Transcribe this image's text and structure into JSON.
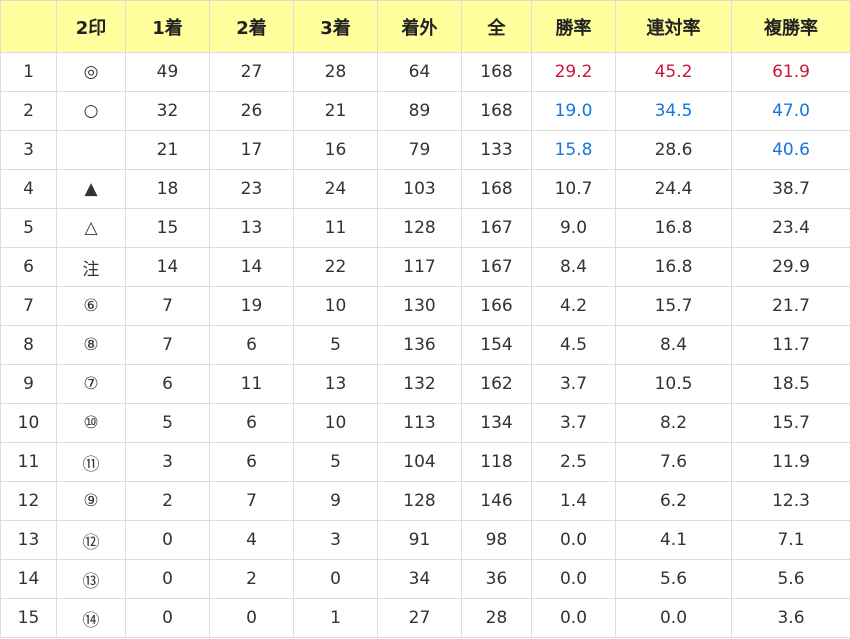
{
  "colors": {
    "header_bg": "#ffff9e",
    "high": "#c8173a",
    "mid": "#1874e0"
  },
  "headers": [
    "",
    "2印",
    "1着",
    "2着",
    "3着",
    "着外",
    "全",
    "勝率",
    "連対率",
    "複勝率"
  ],
  "rows": [
    {
      "no": "1",
      "mark": "◎",
      "c1": "49",
      "c2": "27",
      "c3": "28",
      "out": "64",
      "total": "168",
      "win": "29.2",
      "top2": "45.2",
      "top3": "61.9",
      "hl": [
        "red",
        "red",
        "red"
      ]
    },
    {
      "no": "2",
      "mark": "○",
      "c1": "32",
      "c2": "26",
      "c3": "21",
      "out": "89",
      "total": "168",
      "win": "19.0",
      "top2": "34.5",
      "top3": "47.0",
      "hl": [
        "blue",
        "blue",
        "blue"
      ]
    },
    {
      "no": "3",
      "mark": "",
      "c1": "21",
      "c2": "17",
      "c3": "16",
      "out": "79",
      "total": "133",
      "win": "15.8",
      "top2": "28.6",
      "top3": "40.6",
      "hl": [
        "blue",
        "",
        "blue"
      ]
    },
    {
      "no": "4",
      "mark": "▲",
      "c1": "18",
      "c2": "23",
      "c3": "24",
      "out": "103",
      "total": "168",
      "win": "10.7",
      "top2": "24.4",
      "top3": "38.7",
      "hl": [
        "",
        "",
        ""
      ]
    },
    {
      "no": "5",
      "mark": "△",
      "c1": "15",
      "c2": "13",
      "c3": "11",
      "out": "128",
      "total": "167",
      "win": "9.0",
      "top2": "16.8",
      "top3": "23.4",
      "hl": [
        "",
        "",
        ""
      ]
    },
    {
      "no": "6",
      "mark": "注",
      "c1": "14",
      "c2": "14",
      "c3": "22",
      "out": "117",
      "total": "167",
      "win": "8.4",
      "top2": "16.8",
      "top3": "29.9",
      "hl": [
        "",
        "",
        ""
      ]
    },
    {
      "no": "7",
      "mark": "⑥",
      "c1": "7",
      "c2": "19",
      "c3": "10",
      "out": "130",
      "total": "166",
      "win": "4.2",
      "top2": "15.7",
      "top3": "21.7",
      "hl": [
        "",
        "",
        ""
      ]
    },
    {
      "no": "8",
      "mark": "⑧",
      "c1": "7",
      "c2": "6",
      "c3": "5",
      "out": "136",
      "total": "154",
      "win": "4.5",
      "top2": "8.4",
      "top3": "11.7",
      "hl": [
        "",
        "",
        ""
      ]
    },
    {
      "no": "9",
      "mark": "⑦",
      "c1": "6",
      "c2": "11",
      "c3": "13",
      "out": "132",
      "total": "162",
      "win": "3.7",
      "top2": "10.5",
      "top3": "18.5",
      "hl": [
        "",
        "",
        ""
      ]
    },
    {
      "no": "10",
      "mark": "⑩",
      "c1": "5",
      "c2": "6",
      "c3": "10",
      "out": "113",
      "total": "134",
      "win": "3.7",
      "top2": "8.2",
      "top3": "15.7",
      "hl": [
        "",
        "",
        ""
      ]
    },
    {
      "no": "11",
      "mark": "⑪",
      "c1": "3",
      "c2": "6",
      "c3": "5",
      "out": "104",
      "total": "118",
      "win": "2.5",
      "top2": "7.6",
      "top3": "11.9",
      "hl": [
        "",
        "",
        ""
      ]
    },
    {
      "no": "12",
      "mark": "⑨",
      "c1": "2",
      "c2": "7",
      "c3": "9",
      "out": "128",
      "total": "146",
      "win": "1.4",
      "top2": "6.2",
      "top3": "12.3",
      "hl": [
        "",
        "",
        ""
      ]
    },
    {
      "no": "13",
      "mark": "⑫",
      "c1": "0",
      "c2": "4",
      "c3": "3",
      "out": "91",
      "total": "98",
      "win": "0.0",
      "top2": "4.1",
      "top3": "7.1",
      "hl": [
        "",
        "",
        ""
      ]
    },
    {
      "no": "14",
      "mark": "⑬",
      "c1": "0",
      "c2": "2",
      "c3": "0",
      "out": "34",
      "total": "36",
      "win": "0.0",
      "top2": "5.6",
      "top3": "5.6",
      "hl": [
        "",
        "",
        ""
      ]
    },
    {
      "no": "15",
      "mark": "⑭",
      "c1": "0",
      "c2": "0",
      "c3": "1",
      "out": "27",
      "total": "28",
      "win": "0.0",
      "top2": "0.0",
      "top3": "3.6",
      "hl": [
        "",
        "",
        ""
      ]
    }
  ]
}
